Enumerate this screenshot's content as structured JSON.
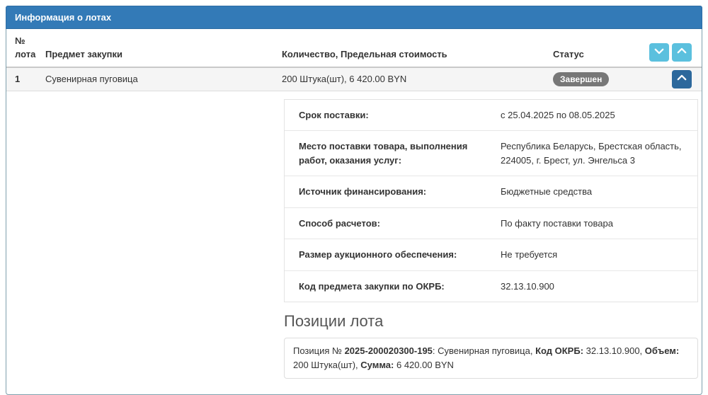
{
  "panel": {
    "title": "Информация о лотах"
  },
  "colors": {
    "panel_header_bg": "#337ab7",
    "panel_border": "#7fa0ad",
    "header_buttons_bg": "#5bc0de",
    "row_toggle_bg": "#2c689c",
    "status_badge_bg": "#777777",
    "row_bg": "#f5f5f5"
  },
  "table": {
    "headers": {
      "num": "№ лота",
      "subject": "Предмет закупки",
      "quantity": "Количество, Предельная стоимость",
      "status": "Статус"
    },
    "rows": [
      {
        "num": "1",
        "subject": "Сувенирная пуговица",
        "quantity": "200 Штука(шт), 6 420.00 BYN",
        "status": "Завершен"
      }
    ]
  },
  "icons": {
    "collapse_all": "chevron-down",
    "expand_all": "chevron-up",
    "lot_toggle": "chevron-up"
  },
  "details": {
    "rows": [
      {
        "label": "Срок поставки:",
        "value": "с 25.04.2025 по 08.05.2025"
      },
      {
        "label": "Место поставки товара, выполнения работ, оказания услуг:",
        "value": "Республика Беларусь, Брестская область, 224005, г. Брест, ул. Энгельса 3"
      },
      {
        "label": "Источник финансирования:",
        "value": "Бюджетные средства"
      },
      {
        "label": "Способ расчетов:",
        "value": "По факту поставки товара"
      },
      {
        "label": "Размер аукционного обеспечения:",
        "value": "Не требуется"
      },
      {
        "label": "Код предмета закупки по ОКРБ:",
        "value": "32.13.10.900"
      }
    ]
  },
  "positions": {
    "heading": "Позиции лота",
    "item": {
      "prefix": "Позиция № ",
      "number": "2025-200020300-195",
      "after_number": ": Сувенирная пуговица, ",
      "okrb_label": "Код ОКРБ:",
      "okrb_value": " 32.13.10.900, ",
      "volume_label": "Объем:",
      "volume_value": " 200 Штука(шт), ",
      "sum_label": "Сумма:",
      "sum_value": " 6 420.00 BYN"
    }
  }
}
